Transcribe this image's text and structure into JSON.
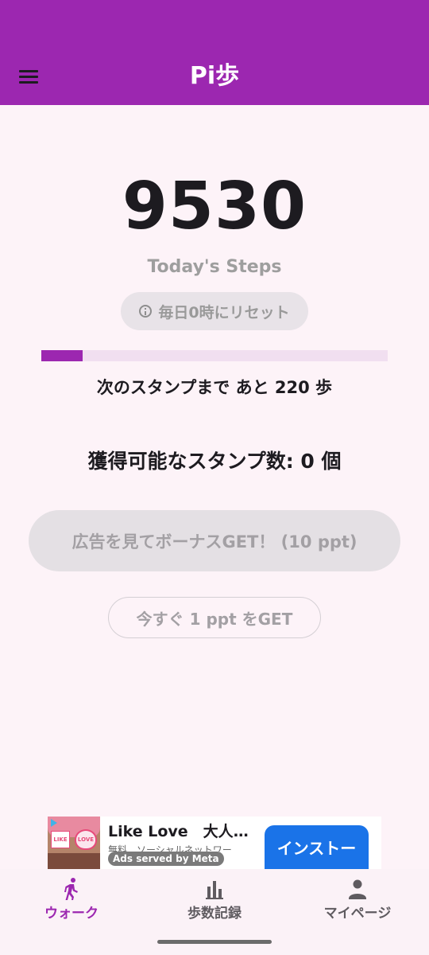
{
  "app_bar": {
    "title": "Pi歩",
    "menu_icon": "menu-icon",
    "color": "#9c27b0"
  },
  "main": {
    "steps_count": "9530",
    "steps_label": "Today's Steps",
    "reset_chip": {
      "icon": "info-icon",
      "text": "毎日0時にリセット"
    },
    "progress": {
      "fraction": 0.12,
      "fill_color": "#9c27b0",
      "track_color": "#f1dff0"
    },
    "next_stamp_text": "次のスタンプまで あと 220 歩",
    "stamp_count_text": "獲得可能なスタンプ数: 0 個",
    "bonus_button_label": "広告を見てボーナスGET！ (10 ppt)",
    "get_now_button_label": "今すぐ 1 ppt をGET"
  },
  "ad": {
    "title": "Like Love　大人の…",
    "subtitle": "無料　ソーシャルネットワー",
    "served_by": "Ads served by Meta",
    "install_label": "インストー",
    "thumb_text_left": "LIKE",
    "thumb_text_right": "LOVE"
  },
  "bottom_nav": {
    "items": [
      {
        "label": "ウォーク",
        "icon": "walk-icon",
        "active": true
      },
      {
        "label": "歩数記録",
        "icon": "bar-chart-icon",
        "active": false
      },
      {
        "label": "マイページ",
        "icon": "person-icon",
        "active": false
      }
    ],
    "active_color": "#9c27b0"
  }
}
